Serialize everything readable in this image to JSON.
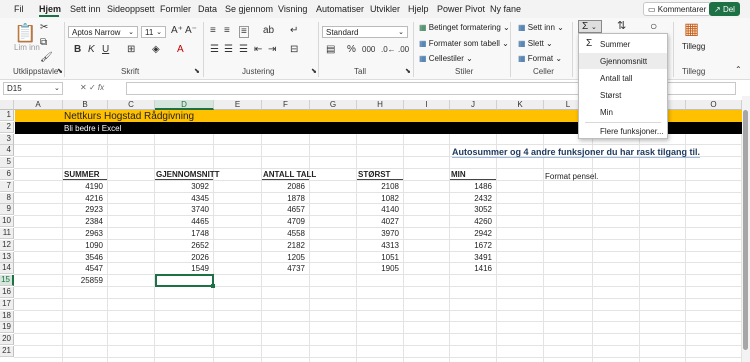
{
  "menubar": {
    "tabs": [
      "Fil",
      "Hjem",
      "Sett inn",
      "Sideoppsett",
      "Formler",
      "Data",
      "Se gjennom",
      "Visning",
      "Automatiser",
      "Utvikler",
      "Hjelp",
      "Power Pivot",
      "Ny fane"
    ],
    "active_tab": "Hjem",
    "comments_label": "Kommentarer",
    "share_label": "Del"
  },
  "ribbon": {
    "clipboard": {
      "paste_label": "Lim inn",
      "group_label": "Utklippstavle"
    },
    "font": {
      "font_name": "Aptos Narrow",
      "font_size": "11",
      "group_label": "Skrift"
    },
    "alignment": {
      "group_label": "Justering"
    },
    "number": {
      "format": "Standard",
      "group_label": "Tall"
    },
    "styles": {
      "conditional": "Betinget formatering",
      "as_table": "Formater som tabell",
      "cell_styles": "Cellestiler",
      "group_label": "Stiler"
    },
    "cells": {
      "insert": "Sett inn",
      "delete": "Slett",
      "format": "Format",
      "group_label": "Celler"
    },
    "addins": {
      "label": "Tillegg",
      "group_label": "Tillegg"
    }
  },
  "autosum_menu": {
    "items": [
      "Summer",
      "Gjennomsnitt",
      "Antall tall",
      "Størst",
      "Min",
      "Flere funksjoner..."
    ],
    "highlighted": "Gjennomsnitt"
  },
  "formula_bar": {
    "namebox": "D15",
    "content": ""
  },
  "sheet": {
    "columns": [
      "A",
      "B",
      "C",
      "D",
      "E",
      "F",
      "G",
      "H",
      "I",
      "J",
      "K",
      "L",
      "M",
      "N",
      "O"
    ],
    "selected_column": "D",
    "rows": [
      "1",
      "2",
      "3",
      "4",
      "5",
      "6",
      "7",
      "8",
      "9",
      "10",
      "11",
      "12",
      "13",
      "14",
      "15",
      "16",
      "17",
      "18",
      "19",
      "20",
      "21"
    ],
    "selected_row": "15",
    "title": "Nettkurs Hogstad Rådgivning",
    "subtitle": "Bli bedre i Excel",
    "note": "Autosummer og 4 andre funksjoner du har rask tilgang til.",
    "format_note": "Format pensel.",
    "headers": {
      "B": "SUMMER",
      "D": "GJENNOMSNITT",
      "F": "ANTALL TALL",
      "H": "STØRST",
      "J": "MIN"
    },
    "data": {
      "B": [
        "4190",
        "4216",
        "2923",
        "2384",
        "2963",
        "1090",
        "3546",
        "4547"
      ],
      "D": [
        "3092",
        "4345",
        "3740",
        "4465",
        "1748",
        "2652",
        "2026",
        "1549"
      ],
      "F": [
        "2086",
        "1878",
        "4657",
        "4709",
        "4558",
        "2182",
        "1205",
        "4737"
      ],
      "H": [
        "2108",
        "1082",
        "4140",
        "4027",
        "3970",
        "4313",
        "1051",
        "1905"
      ],
      "J": [
        "1486",
        "2432",
        "3052",
        "4260",
        "2942",
        "1672",
        "3491",
        "1416"
      ]
    },
    "total_B15": "25859"
  },
  "colors": {
    "accent": "#1e7145",
    "title_band": "#ffc000",
    "subtitle_band": "#000000"
  }
}
